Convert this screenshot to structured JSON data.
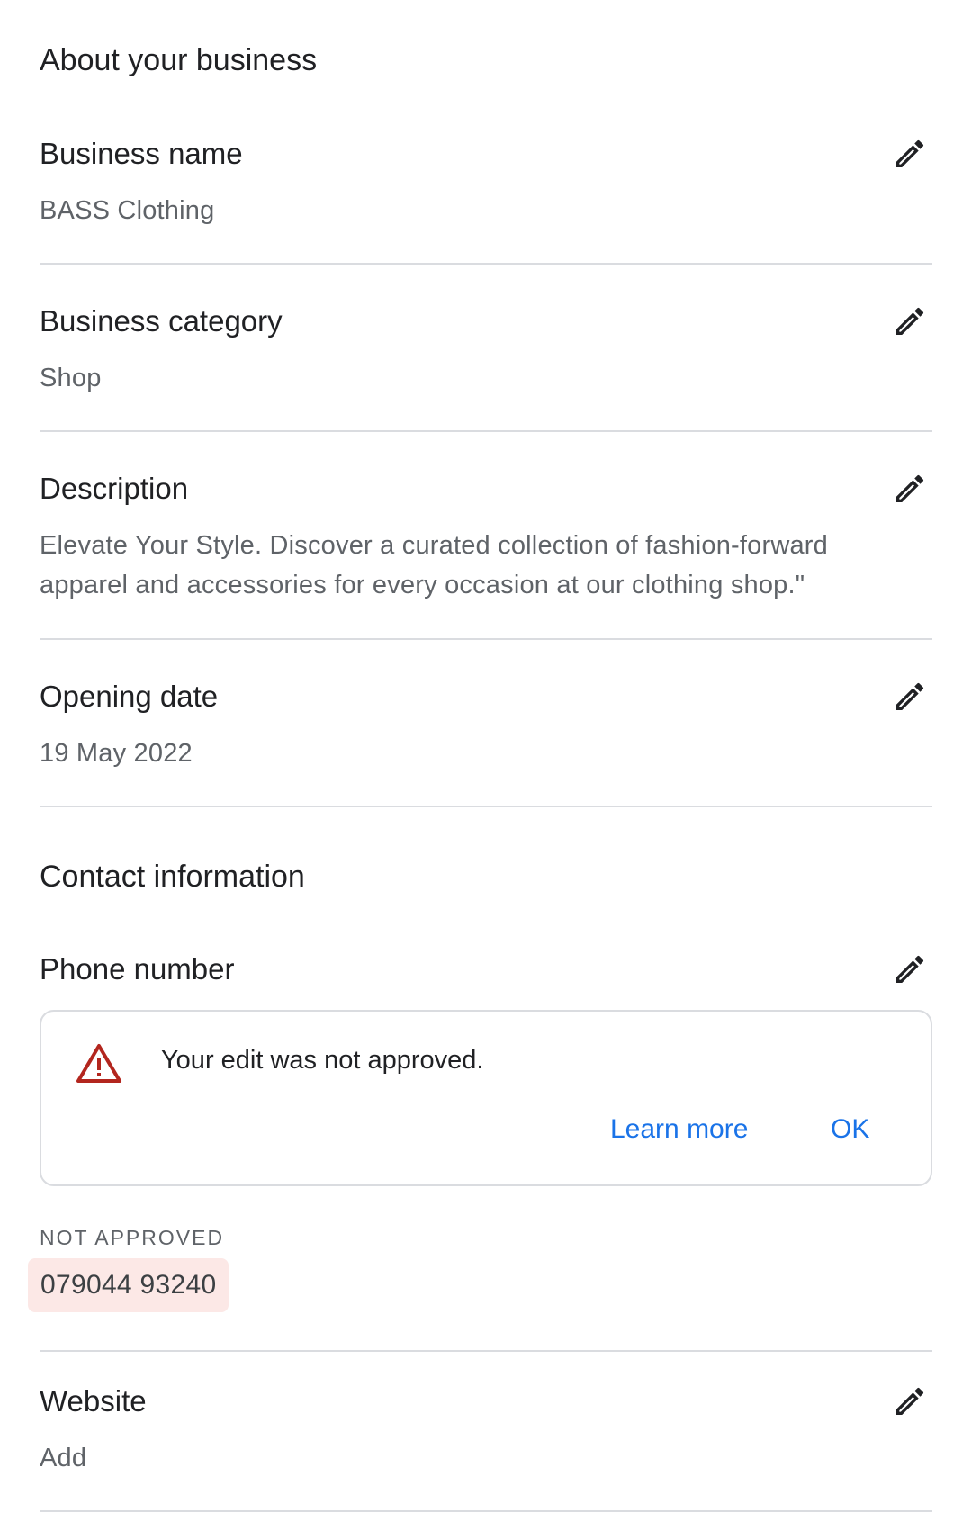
{
  "about": {
    "title": "About your business",
    "business_name": {
      "label": "Business name",
      "value": "BASS Clothing"
    },
    "business_category": {
      "label": "Business category",
      "value": "Shop"
    },
    "description": {
      "label": "Description",
      "line1": "Elevate Your Style. Discover a curated collection of fashion-forward",
      "line2": "apparel and accessories for every occasion at our clothing shop.\""
    },
    "opening_date": {
      "label": "Opening date",
      "value": "19 May 2022"
    }
  },
  "contact": {
    "title": "Contact information",
    "phone": {
      "label": "Phone number",
      "notice_text": "Your edit was not approved.",
      "learn_more": "Learn more",
      "ok": "OK",
      "status": "NOT APPROVED",
      "value": "079044 93240"
    },
    "website": {
      "label": "Website",
      "value": "Add"
    }
  },
  "colors": {
    "accent": "#1a73e8",
    "warning": "#b3261e",
    "rejected_bg": "#fce8e6",
    "divider": "#dadce0"
  },
  "icons": {
    "edit": "pencil-icon",
    "warning": "warning-triangle-icon"
  }
}
